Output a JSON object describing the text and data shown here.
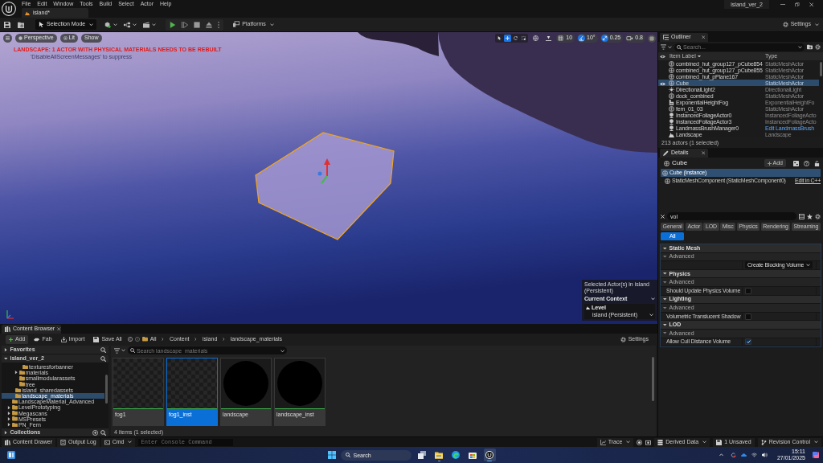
{
  "titlebar": {
    "menu": [
      "File",
      "Edit",
      "Window",
      "Tools",
      "Build",
      "Select",
      "Actor",
      "Help"
    ],
    "level_tab": "island*",
    "project": "island_ver_2"
  },
  "toolbar": {
    "mode": "Selection Mode",
    "platforms": "Platforms",
    "settings": "Settings"
  },
  "viewport": {
    "view_buttons": [
      {
        "kind": "camera",
        "label": "Perspective"
      },
      {
        "kind": "lit",
        "label": "Lit"
      },
      {
        "kind": "show",
        "label": "Show"
      }
    ],
    "message": "LANDSCAPE: 1 ACTOR WITH PHYSICAL MATERIALS NEEDS TO BE REBUILT",
    "hint": "'DisableAllScreenMessages' to suppress",
    "tools": [
      {
        "kind": "select",
        "selected": false
      },
      {
        "kind": "move",
        "selected": true
      },
      {
        "kind": "rotate",
        "selected": false
      },
      {
        "kind": "scale",
        "selected": false
      }
    ],
    "snaps": [
      {
        "kind": "grid",
        "value": "10",
        "on": false
      },
      {
        "kind": "angle",
        "value": "10°",
        "on": true
      },
      {
        "kind": "scale",
        "value": "0.25",
        "on": true
      }
    ],
    "camera_speed": "0.8",
    "context": {
      "selected_in": "Selected Actor(s) in island (Persistent)",
      "title": "Current Context",
      "level_label": "Level",
      "level": "island (Persistent)"
    }
  },
  "outliner": {
    "title": "Outliner",
    "search": {
      "placeholder": "Search..."
    },
    "columns": [
      "Item Label",
      "Type"
    ],
    "rows": [
      {
        "label": "combined_hut_group127_pCube854",
        "type": "StaticMeshActor",
        "kind": "mesh",
        "type_link": false,
        "selected": false
      },
      {
        "label": "combined_hut_group127_pCube855",
        "type": "StaticMeshActor",
        "kind": "mesh",
        "type_link": false,
        "selected": false
      },
      {
        "label": "combined_hut_pPlane167",
        "type": "StaticMeshActor",
        "kind": "mesh",
        "type_link": false,
        "selected": false
      },
      {
        "label": "Cube",
        "type": "StaticMeshActor",
        "kind": "mesh",
        "type_link": false,
        "selected": true
      },
      {
        "label": "DirectionalLight2",
        "type": "DirectionalLight",
        "kind": "light",
        "type_link": false,
        "selected": false
      },
      {
        "label": "dock_combined",
        "type": "StaticMeshActor",
        "kind": "mesh",
        "type_link": false,
        "selected": false
      },
      {
        "label": "ExponentialHeightFog",
        "type": "ExponentialHeightFo",
        "kind": "fog",
        "type_link": false,
        "selected": false
      },
      {
        "label": "fern_01_03",
        "type": "StaticMeshActor",
        "kind": "mesh",
        "type_link": false,
        "selected": false
      },
      {
        "label": "InstancedFoliageActor0",
        "type": "InstancedFoliageActo",
        "kind": "foliage",
        "type_link": false,
        "selected": false
      },
      {
        "label": "InstancedFoliageActor3",
        "type": "InstancedFoliageActo",
        "kind": "foliage",
        "type_link": false,
        "selected": false
      },
      {
        "label": "LandmassBrushManager0",
        "type": "Edit LandmassBrush",
        "kind": "foliage",
        "type_link": true,
        "selected": false
      },
      {
        "label": "Landscape",
        "type": "Landscape",
        "kind": "landscape",
        "type_link": false,
        "selected": false
      }
    ],
    "status": "213 actors (1 selected)"
  },
  "details": {
    "title": "Details",
    "actor": "Cube",
    "add": "Add",
    "components": [
      {
        "label": "Cube (Instance)",
        "selected": true
      },
      {
        "label": "StaticMeshComponent (StaticMeshComponent0)",
        "selected": false,
        "link": "Edit in C++"
      }
    ],
    "search": {
      "value": "vol"
    },
    "filters": [
      {
        "label": "General",
        "selected": false
      },
      {
        "label": "Actor",
        "selected": false
      },
      {
        "label": "LOD",
        "selected": false
      },
      {
        "label": "Misc",
        "selected": false
      },
      {
        "label": "Physics",
        "selected": false
      },
      {
        "label": "Rendering",
        "selected": false
      },
      {
        "label": "Streaming",
        "selected": false
      },
      {
        "label": "All",
        "selected": true
      }
    ],
    "sections": [
      {
        "title": "Static Mesh",
        "expanded": true,
        "groups": [
          {
            "title": "Advanced",
            "expanded": true,
            "properties": [
              {
                "kind": "button",
                "value": "Create Blocking Volume"
              }
            ]
          }
        ]
      },
      {
        "title": "Physics",
        "expanded": true,
        "groups": [
          {
            "title": "Advanced",
            "expanded": true,
            "properties": [
              {
                "kind": "checkbox",
                "label": "Should Update Physics Volume",
                "checked": false
              }
            ]
          }
        ]
      },
      {
        "title": "Lighting",
        "expanded": true,
        "groups": [
          {
            "title": "Advanced",
            "expanded": true,
            "properties": [
              {
                "kind": "checkbox",
                "label": "Volumetric Translucent Shadow",
                "checked": false
              }
            ]
          }
        ]
      },
      {
        "title": "LOD",
        "expanded": true,
        "groups": [
          {
            "title": "Advanced",
            "expanded": true,
            "properties": [
              {
                "kind": "checkbox",
                "label": "Allow Cull Distance Volume",
                "checked": true
              }
            ]
          }
        ]
      }
    ]
  },
  "content_browser": {
    "title": "Content Browser",
    "buttons": [
      {
        "kind": "add",
        "label": "Add"
      },
      {
        "kind": "fab",
        "label": "Fab"
      },
      {
        "kind": "import",
        "label": "Import"
      },
      {
        "kind": "save",
        "label": "Save All"
      }
    ],
    "path": [
      "All",
      "Content",
      "island",
      "landscape_materials"
    ],
    "settings": "Settings",
    "favorites": {
      "label": "Favorites",
      "expanded": false
    },
    "root": {
      "label": "island_ver_2",
      "expanded": true
    },
    "tree": [
      {
        "children": [
          {
            "children": [
              {
                "children": [
                  {
                    "children": [
                      {
                        "label": "texturesforbanner",
                        "expandable": false,
                        "selected": false
                      }
                    ]
                  },
                  {
                    "label": "materials",
                    "expandable": true,
                    "selected": false
                  },
                  {
                    "label": "smallmodularassets",
                    "expandable": false,
                    "selected": false
                  },
                  {
                    "label": "tree",
                    "expandable": false,
                    "selected": false
                  }
                ]
              },
              {
                "label": "island_sharedassets",
                "expandable": false,
                "selected": false
              },
              {
                "label": "landscape_materials",
                "expandable": false,
                "selected": true
              }
            ]
          },
          {
            "label": "LandscapeMaterial_Advanced",
            "expandable": false,
            "selected": false
          },
          {
            "label": "LevelPrototyping",
            "expandable": true,
            "selected": false
          },
          {
            "label": "Megascans",
            "expandable": true,
            "selected": false
          },
          {
            "label": "MSPresets",
            "expandable": true,
            "selected": false
          },
          {
            "label": "PN_Fern",
            "expandable": true,
            "selected": false
          }
        ]
      }
    ],
    "collections": {
      "label": "Collections",
      "expanded": false
    },
    "search": {
      "placeholder": "Search landscape_materials"
    },
    "assets": [
      {
        "label": "fog1",
        "kind": "checker",
        "selected": false
      },
      {
        "label": "fog1_inst",
        "kind": "checker",
        "selected": true
      },
      {
        "label": "landscape",
        "kind": "sphere",
        "selected": false
      },
      {
        "label": "landscape_inst",
        "kind": "sphere",
        "selected": false
      }
    ],
    "count": "4 items (1 selected)"
  },
  "status_bar": {
    "left": [
      {
        "kind": "drawer",
        "label": "Content Drawer",
        "menu": false
      },
      {
        "kind": "log",
        "label": "Output Log",
        "menu": false
      },
      {
        "kind": "cmd",
        "label": "Cmd",
        "menu": true
      }
    ],
    "console": {
      "placeholder": "Enter Console Command"
    },
    "right": [
      {
        "kind": "trace",
        "label": "Trace",
        "menu": true
      },
      {
        "kind": "derived",
        "label": "Derived Data",
        "menu": true
      },
      {
        "kind": "unsaved",
        "label": "1 Unsaved",
        "menu": false
      },
      {
        "kind": "revision",
        "label": "Revision Control",
        "menu": true
      }
    ]
  },
  "taskbar": {
    "search": {
      "placeholder": "Search"
    },
    "apps": [
      {
        "kind": "taskview",
        "running": false,
        "selected": false
      },
      {
        "kind": "explorer",
        "running": true,
        "selected": false
      },
      {
        "kind": "edge",
        "running": false,
        "selected": false
      },
      {
        "kind": "store",
        "running": false,
        "selected": false
      },
      {
        "kind": "unreal",
        "running": true,
        "selected": true
      }
    ],
    "time": "15:11",
    "date": "27/01/2025"
  }
}
